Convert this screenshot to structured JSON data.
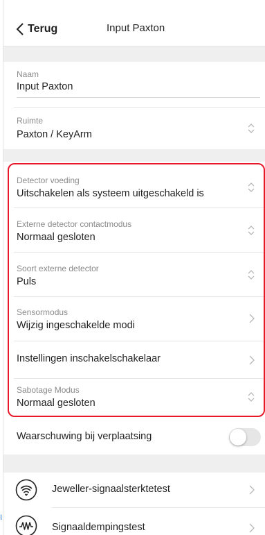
{
  "header": {
    "back_label": "Terug",
    "title": "Input Paxton"
  },
  "fields": {
    "name": {
      "label": "Naam",
      "value": "Input Paxton"
    },
    "room": {
      "label": "Ruimte",
      "value": "Paxton / KeyArm"
    }
  },
  "highlighted_settings": [
    {
      "label": "Detector voeding",
      "value": "Uitschakelen als systeem uitgeschakeld is",
      "control": "updown-icon"
    },
    {
      "label": "Externe detector contactmodus",
      "value": "Normaal gesloten",
      "control": "updown-icon"
    },
    {
      "label": "Soort externe detector",
      "value": "Puls",
      "control": "updown-icon"
    },
    {
      "label": "Sensormodus",
      "value": "Wijzig ingeschakelde modi",
      "control": "chevron-right-icon"
    },
    {
      "label": "",
      "value": "Instellingen inschakelschakelaar",
      "control": "chevron-right-icon"
    },
    {
      "label": "Sabotage Modus",
      "value": "Normaal gesloten",
      "control": "updown-icon"
    }
  ],
  "movement_warning": {
    "label": "Waarschuwing bij verplaatsing",
    "enabled": false
  },
  "tests": [
    {
      "label": "Jeweller-signaalsterktetest",
      "icon": "signal-strength-icon"
    },
    {
      "label": "Signaaldempingstest",
      "icon": "signal-damping-icon"
    }
  ],
  "colors": {
    "highlight_border": "#e8182b",
    "background": "#efefef",
    "toggle_off": "#e6e6e6"
  }
}
